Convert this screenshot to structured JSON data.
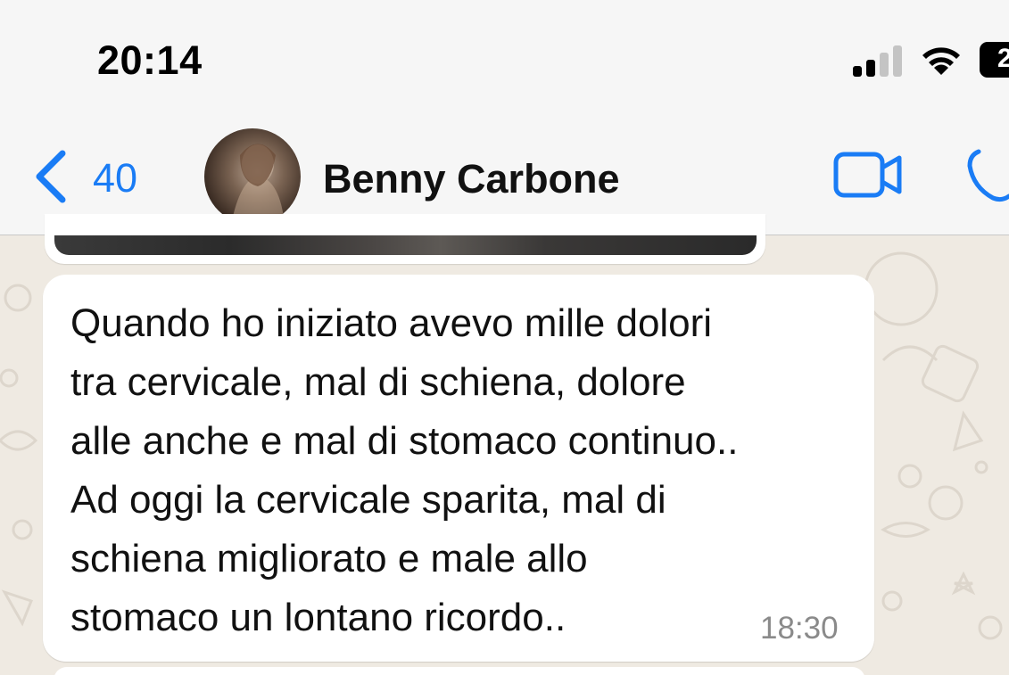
{
  "status_bar": {
    "time": "20:14",
    "battery_level": "2"
  },
  "header": {
    "back_count": "40",
    "contact_name": "Benny Carbone"
  },
  "message": {
    "lines": [
      "Quando ho iniziato avevo mille dolori",
      "tra cervicale, mal di schiena, dolore",
      "alle anche e mal di stomaco continuo..",
      "Ad oggi la cervicale sparita, mal di",
      "schiena migliorato e male allo",
      "stomaco un lontano ricordo.."
    ],
    "time": "18:30"
  },
  "colors": {
    "accent": "#1a7cf5",
    "chat_background": "#efeae2",
    "bubble": "#ffffff"
  },
  "icons": [
    "signal-icon",
    "wifi-icon",
    "battery-icon",
    "chevron-left-icon",
    "video-call-icon",
    "phone-icon"
  ]
}
